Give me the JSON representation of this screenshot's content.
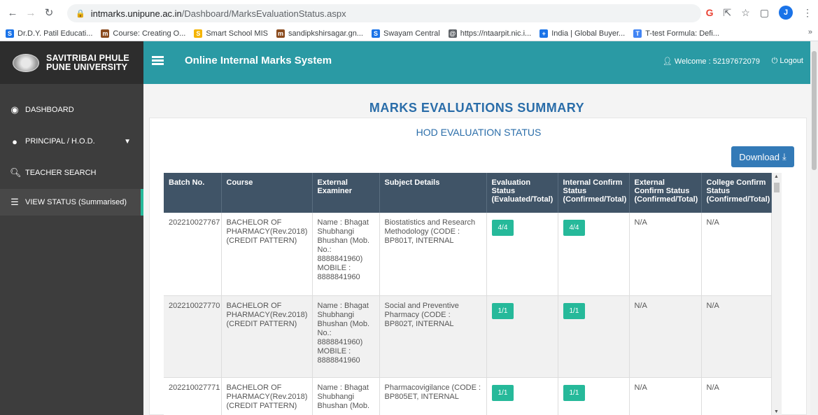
{
  "browser": {
    "url_host": "intmarks.unipune.ac.in",
    "url_path": "/Dashboard/MarksEvaluationStatus.aspx",
    "profile_initial": "J",
    "bookmarks": [
      {
        "label": "Dr.D.Y. Patil Educati...",
        "color": "#1a73e8",
        "glyph": "S"
      },
      {
        "label": "Course: Creating O...",
        "color": "#8a4b1e",
        "glyph": "m"
      },
      {
        "label": "Smart School MIS",
        "color": "#f4b400",
        "glyph": "S"
      },
      {
        "label": "sandipkshirsagar.gn...",
        "color": "#8a4b1e",
        "glyph": "m"
      },
      {
        "label": "Swayam Central",
        "color": "#1a73e8",
        "glyph": "S"
      },
      {
        "label": "https://ntaarpit.nic.i...",
        "color": "#5f6368",
        "glyph": "@"
      },
      {
        "label": "India | Global Buyer...",
        "color": "#1a73e8",
        "glyph": "+"
      },
      {
        "label": "T-test Formula: Defi...",
        "color": "#4285f4",
        "glyph": "T"
      }
    ]
  },
  "brand": {
    "line1": "SAVITRIBAI PHULE",
    "line2": "PUNE UNIVERSITY"
  },
  "sidebar": {
    "items": [
      {
        "label": "DASHBOARD",
        "icon": "dashboard-icon"
      },
      {
        "label": "PRINCIPAL / H.O.D.",
        "icon": "user-icon"
      },
      {
        "label": "TEACHER SEARCH",
        "icon": "search-icon"
      },
      {
        "label": "VIEW STATUS (Summarised)",
        "icon": "list-icon"
      }
    ]
  },
  "header": {
    "title": "Online Internal Marks System",
    "welcome": "Welcome : 52197672079",
    "logout": "Logout"
  },
  "main": {
    "page_title": "MARKS EVALUATIONS SUMMARY",
    "card_title": "HOD EVALUATION STATUS",
    "download_label": "Download"
  },
  "table": {
    "headers": [
      "Batch No.",
      "Course",
      "External Examiner",
      "Subject Details",
      "Evaluation Status (Evaluated/Total)",
      "Internal Confirm Status (Confirmed/Total)",
      "External Confirm Status (Confirmed/Total)",
      "College Confirm Status (Confirmed/Total)"
    ],
    "rows": [
      {
        "batch": "202210027767",
        "course": "BACHELOR OF PHARMACY(Rev.2018) (CREDIT PATTERN)",
        "examiner": "Name : Bhagat Shubhangi Bhushan (Mob. No.: 8888841960) MOBILE : 8888841960",
        "subject": "Biostatistics and Research Methodology (CODE : BP801T, INTERNAL",
        "eval": "4/4",
        "internal": "4/4",
        "external": "N/A",
        "college": "N/A"
      },
      {
        "batch": "202210027770",
        "course": "BACHELOR OF PHARMACY(Rev.2018) (CREDIT PATTERN)",
        "examiner": "Name : Bhagat Shubhangi Bhushan (Mob. No.: 8888841960) MOBILE : 8888841960",
        "subject": "Social and Preventive Pharmacy (CODE : BP802T, INTERNAL",
        "eval": "1/1",
        "internal": "1/1",
        "external": "N/A",
        "college": "N/A"
      },
      {
        "batch": "202210027771",
        "course": "BACHELOR OF PHARMACY(Rev.2018) (CREDIT PATTERN)",
        "examiner": "Name : Bhagat Shubhangi Bhushan (Mob.",
        "subject": "Pharmacovigilance (CODE : BP805ET, INTERNAL",
        "eval": "1/1",
        "internal": "1/1",
        "external": "N/A",
        "college": "N/A"
      }
    ]
  },
  "colors": {
    "topbar": "#2a9aa4",
    "sidebar": "#3d3d3d",
    "table_header": "#405467",
    "badge": "#26b99a",
    "title_blue": "#2a6da9",
    "download_btn": "#337ab7"
  }
}
